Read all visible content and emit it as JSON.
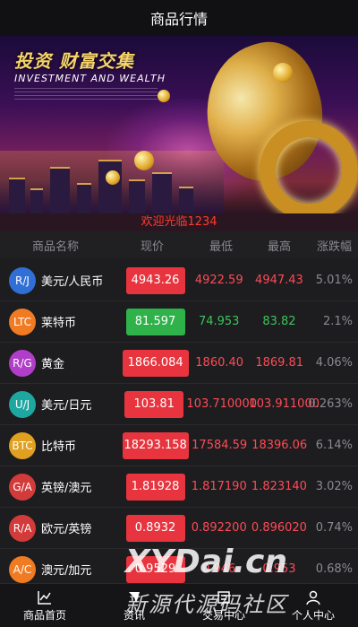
{
  "topbar": {
    "title": "商品行情"
  },
  "banner": {
    "heading": "投资 财富交集",
    "subheading": "INVESTMENT AND WEALTH"
  },
  "welcome": "欢迎光临1234",
  "columns": {
    "name": "商品名称",
    "price": "现价",
    "low": "最低",
    "high": "最高",
    "change": "涨跌幅"
  },
  "rows": [
    {
      "code": "R/J",
      "color": "#2f6fd6",
      "name": "美元/人民币",
      "price": "4943.26",
      "dir": "up",
      "low": "4922.59",
      "high": "4947.43",
      "change": "5.01%"
    },
    {
      "code": "LTC",
      "color": "#f07b22",
      "name": "莱特币",
      "price": "81.597",
      "dir": "down",
      "low": "74.953",
      "high": "83.82",
      "change": "2.1%"
    },
    {
      "code": "R/G",
      "color": "#b03ec8",
      "name": "黄金",
      "price": "1866.084",
      "dir": "up",
      "low": "1860.40",
      "high": "1869.81",
      "change": "4.06%"
    },
    {
      "code": "U/J",
      "color": "#1ea7a0",
      "name": "美元/日元",
      "price": "103.81",
      "dir": "up",
      "low": "103.710000",
      "high": "103.911000",
      "change": "0.263%"
    },
    {
      "code": "BTC",
      "color": "#e0a020",
      "name": "比特币",
      "price": "18293.158",
      "dir": "up",
      "low": "17584.59",
      "high": "18396.06",
      "change": "6.14%"
    },
    {
      "code": "G/A",
      "color": "#d33a3a",
      "name": "英镑/澳元",
      "price": "1.81928",
      "dir": "up",
      "low": "1.817190",
      "high": "1.823140",
      "change": "3.02%"
    },
    {
      "code": "R/A",
      "color": "#d33a3a",
      "name": "欧元/英镑",
      "price": "0.8932",
      "dir": "up",
      "low": "0.892200",
      "high": "0.896020",
      "change": "0.74%"
    },
    {
      "code": "A/C",
      "color": "#f07b22",
      "name": "澳元/加元",
      "price": "0.9529",
      "dir": "up",
      "low": "0.946",
      "high": "0.953",
      "change": "0.68%"
    }
  ],
  "tabs": [
    {
      "label": "商品首页",
      "icon": "chart-icon"
    },
    {
      "label": "资讯",
      "icon": "news-icon"
    },
    {
      "label": "交易中心",
      "icon": "trade-icon"
    },
    {
      "label": "个人中心",
      "icon": "user-icon"
    }
  ],
  "watermark": {
    "line1": "XYDai.cn",
    "line2": "新源代源码社区"
  }
}
